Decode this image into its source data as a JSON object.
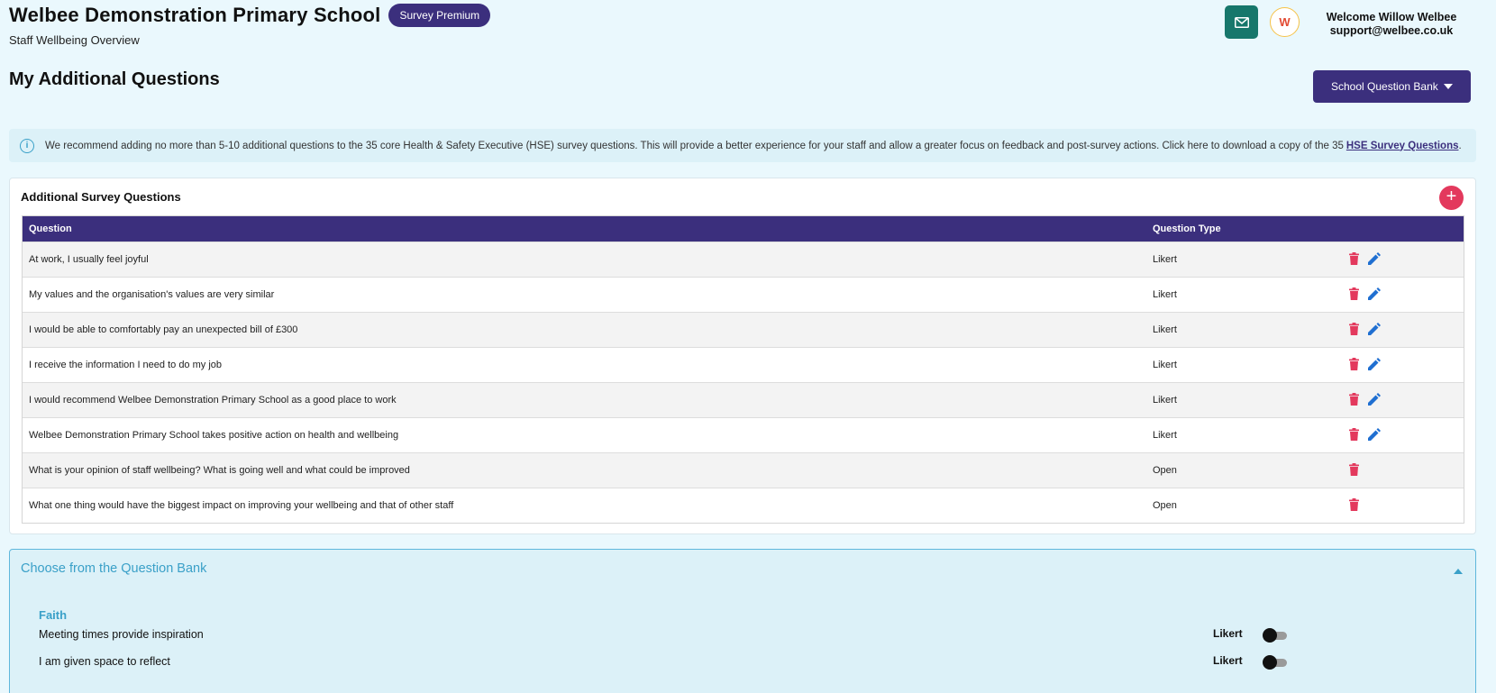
{
  "header": {
    "school_name": "Welbee Demonstration Primary School",
    "badge": "Survey Premium",
    "subtitle": "Staff Wellbeing Overview",
    "welcome_line1": "Welcome Willow Welbee",
    "welcome_line2": "support@welbee.co.uk",
    "avatar_letter": "W",
    "icons": {
      "mail": "mail-icon"
    }
  },
  "page": {
    "title": "My Additional Questions",
    "bank_button": "School Question Bank"
  },
  "info": {
    "text": "We recommend adding no more than 5-10 additional questions to the 35 core Health & Safety Executive (HSE) survey questions. This will provide a better experience for your staff and allow a greater focus on feedback and post-survey actions. Click here to download a copy of the 35",
    "link": "HSE Survey Questions",
    "suffix": "."
  },
  "additional": {
    "title": "Additional Survey Questions",
    "add_symbol": "+",
    "columns": [
      "Question",
      "Question Type"
    ],
    "rows": [
      {
        "question": "At work, I usually feel joyful",
        "type": "Likert",
        "editable": true
      },
      {
        "question": "My values and the organisation's values are very similar",
        "type": "Likert",
        "editable": true
      },
      {
        "question": "I would be able to comfortably pay an unexpected bill of £300",
        "type": "Likert",
        "editable": true
      },
      {
        "question": "I receive the information I need to do my job",
        "type": "Likert",
        "editable": true
      },
      {
        "question": "I would recommend Welbee Demonstration Primary School as a good place to work",
        "type": "Likert",
        "editable": true
      },
      {
        "question": "Welbee Demonstration Primary School takes positive action on health and wellbeing",
        "type": "Likert",
        "editable": true
      },
      {
        "question": "What is your opinion of staff wellbeing? What is going well and what could be improved",
        "type": "Open",
        "editable": false
      },
      {
        "question": "What one thing would have the biggest impact on improving your wellbeing and that of other staff",
        "type": "Open",
        "editable": false
      }
    ]
  },
  "question_bank": {
    "title": "Choose from the Question Bank",
    "category": "Faith",
    "items": [
      {
        "label": "Meeting times provide inspiration",
        "type": "Likert"
      },
      {
        "label": "I am given space to reflect",
        "type": "Likert"
      }
    ]
  },
  "colors": {
    "primary": "#3b2f7d",
    "accent_red": "#e3395d",
    "edit_blue": "#1f6fd1",
    "teal": "#17776b",
    "light_blue": "#3aa0c8"
  }
}
